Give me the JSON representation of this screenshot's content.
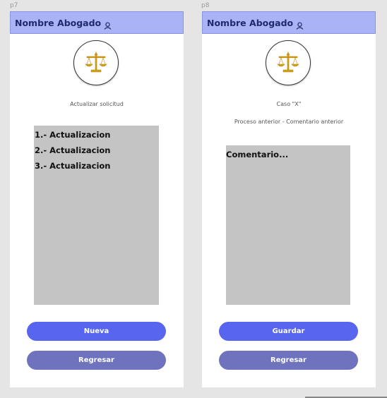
{
  "p7": {
    "frame_label": "p7",
    "header": {
      "title": "Nombre Abogado"
    },
    "caption": "Actualizar solicitud",
    "list_items": [
      "1.- Actualizacion",
      "2.- Actualizacion",
      "3.- Actualizacion"
    ],
    "primary_button": "Nueva",
    "secondary_button": "Regresar"
  },
  "p8": {
    "frame_label": "p8",
    "header": {
      "title": "Nombre Abogado"
    },
    "case_caption": "Caso \"X\"",
    "process_caption": "Proceso anterior - Comentario anterior",
    "comment_placeholder": "Comentario...",
    "primary_button": "Guardar",
    "secondary_button": "Regresar"
  },
  "colors": {
    "header_bg": "#aab3f5",
    "primary_button": "#5865ef",
    "secondary_button": "#6f73bd",
    "textbox_bg": "#c4c4c4",
    "logo_gold": "#d4a017"
  },
  "icons": {
    "header": "user-icon",
    "logo": "scales-of-justice-icon"
  }
}
